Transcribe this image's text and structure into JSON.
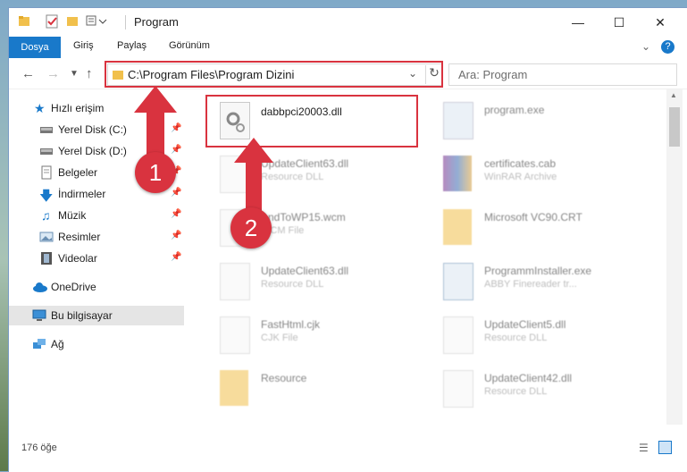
{
  "window": {
    "title": "Program"
  },
  "ribbon": {
    "tabs": [
      "Dosya",
      "Giriş",
      "Paylaş",
      "Görünüm"
    ]
  },
  "address": {
    "path": "C:\\Program Files\\Program Dizini",
    "search_placeholder": "Ara: Program"
  },
  "sidebar": {
    "items": [
      {
        "label": "Hızlı erişim"
      },
      {
        "label": "Yerel Disk (C:)"
      },
      {
        "label": "Yerel Disk (D:)"
      },
      {
        "label": "Belgeler"
      },
      {
        "label": "İndirmeler"
      },
      {
        "label": "Müzik"
      },
      {
        "label": "Resimler"
      },
      {
        "label": "Videolar"
      },
      {
        "label": "OneDrive"
      },
      {
        "label": "Bu bilgisayar"
      },
      {
        "label": "Ağ"
      }
    ]
  },
  "files": [
    {
      "name": "dabbpci20003.dll",
      "type": ""
    },
    {
      "name": "program.exe",
      "type": ""
    },
    {
      "name": "UpdateClient63.dll",
      "type": "Resource DLL"
    },
    {
      "name": "certificates.cab",
      "type": "WinRAR Archive"
    },
    {
      "name": "AndToWP15.wcm",
      "type": "WCM File"
    },
    {
      "name": "Microsoft VC90.CRT",
      "type": ""
    },
    {
      "name": "UpdateClient63.dll",
      "type": "Resource DLL"
    },
    {
      "name": "ProgrammInstaller.exe",
      "type": "ABBY Finereader tr..."
    },
    {
      "name": "FastHtml.cjk",
      "type": "CJK File"
    },
    {
      "name": "UpdateClient5.dll",
      "type": "Resource DLL"
    },
    {
      "name": "Resource",
      "type": ""
    },
    {
      "name": "UpdateClient42.dll",
      "type": "Resource DLL"
    }
  ],
  "status": {
    "count": "176 öğe"
  },
  "annotations": {
    "step1": "1",
    "step2": "2"
  },
  "colors": {
    "accent": "#1979ca",
    "marker": "#d9333f"
  }
}
